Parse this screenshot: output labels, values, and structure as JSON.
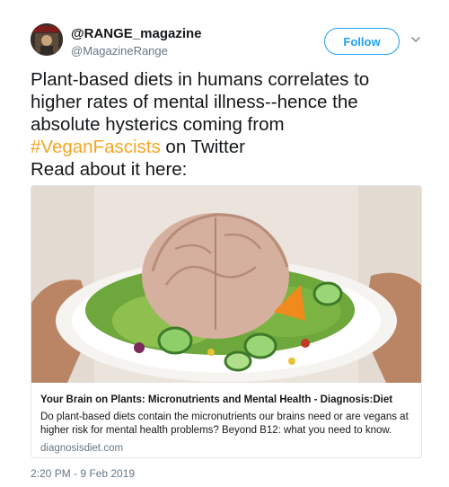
{
  "user": {
    "display_name": "@RANGE_magazine",
    "handle": "@MagazineRange"
  },
  "follow_button": {
    "label": "Follow"
  },
  "tweet": {
    "line1": "Plant-based diets in humans correlates to",
    "line2": "higher rates of mental illness--hence the",
    "line3": "absolute hysterics coming from",
    "hashtag": "#VeganFascists",
    "line4_rest": " on Twitter",
    "line5": "Read about it here:"
  },
  "card": {
    "title": "Your Brain on Plants: Micronutrients and Mental Health - Diagnosis:Diet",
    "description": "Do plant-based diets contain the micronutrients our brains need or are vegans at higher risk for mental health problems? Beyond B12: what you need to know.",
    "domain": "diagnosisdiet.com"
  },
  "timestamp": "2:20 PM - 9 Feb 2019",
  "colors": {
    "accent": "#1da1f2",
    "hashtag": "#f5a623",
    "secondary_text": "#657786"
  },
  "icons": {
    "caret": "chevron-down-icon"
  }
}
